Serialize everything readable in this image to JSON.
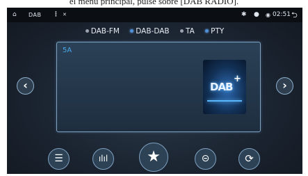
{
  "caption": {
    "text": "el menú principal, pulse sobre [DAB RADIO]."
  },
  "statusbar": {
    "home_icon": "⌂",
    "app_label": "DAB",
    "menu_icon": "⋮",
    "misc_icon": "✕",
    "bluetooth_icon": "✱",
    "location_icon": "●",
    "wifi_icon": "◉",
    "time": "02:51",
    "back_icon": "⮌"
  },
  "options": [
    {
      "label": "DAB-FM",
      "active": false
    },
    {
      "label": "DAB-DAB",
      "active": true
    },
    {
      "label": "TA",
      "active": false
    },
    {
      "label": "PTY",
      "active": true
    }
  ],
  "panel": {
    "station": "5A",
    "logo_text": "DAB",
    "logo_plus": "+"
  },
  "nav": {
    "prev_icon": "‹",
    "next_icon": "›"
  },
  "controls": {
    "list_icon": "☰",
    "eq_icon": "ılıl",
    "favorite_icon": "★",
    "scan_icon": "⊝",
    "refresh_icon": "⟳"
  },
  "colors": {
    "accent": "#4f8fd6",
    "panel_border": "#7fa3c2",
    "background": "#1b2431"
  }
}
